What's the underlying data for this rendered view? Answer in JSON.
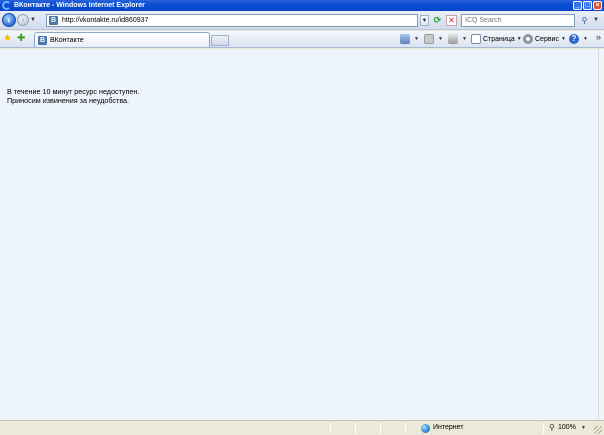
{
  "window": {
    "title": "ВКонтакте - Windows Internet Explorer",
    "buttons": {
      "minimize": "_",
      "maximize": "□",
      "close": "×"
    }
  },
  "addressbar": {
    "url": "http://vkontakte.ru/id860937",
    "search_placeholder": "ICQ Search"
  },
  "tab": {
    "label": "ВКонтакте",
    "favicon_letter": "B"
  },
  "commandbar": {
    "page_label": "Страница",
    "tools_label": "Сервис",
    "help_label": "?",
    "more": "»"
  },
  "content": {
    "line1": "В течение 10 минут ресурс недоступен.",
    "line2": "Приносим извинения за неудобства."
  },
  "statusbar": {
    "zone": "Интернет",
    "zoom": "100%"
  },
  "icons": {
    "back": "back-arrow-icon",
    "forward": "forward-arrow-icon",
    "refresh": "refresh-icon",
    "stop": "stop-icon",
    "search": "search-icon",
    "favorites": "star-icon",
    "add_favorites": "add-favorites-icon",
    "home": "home-icon",
    "feeds": "feeds-icon",
    "print": "print-icon",
    "page": "page-icon",
    "tools": "gear-icon",
    "help": "help-icon",
    "zone": "globe-icon",
    "zoom": "zoom-icon"
  }
}
